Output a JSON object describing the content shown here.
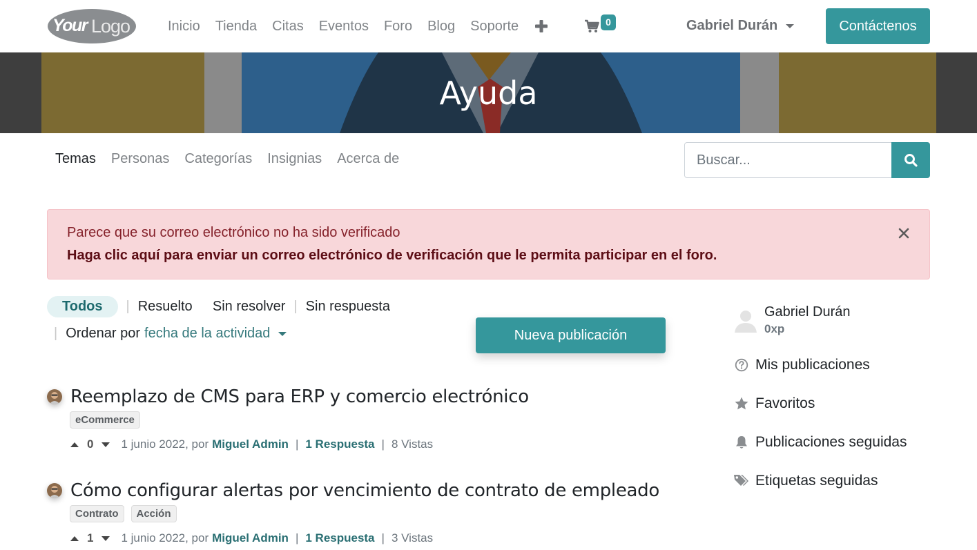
{
  "navbar": {
    "logo_text": "YourLogo",
    "links": [
      "Inicio",
      "Tienda",
      "Citas",
      "Eventos",
      "Foro",
      "Blog",
      "Soporte"
    ],
    "cart_count": "0",
    "user_name": "Gabriel Durán",
    "contact_label": "Contáctenos"
  },
  "banner": {
    "title": "Ayuda"
  },
  "forum_nav": {
    "tabs": [
      "Temas",
      "Personas",
      "Categorías",
      "Insignias",
      "Acerca de"
    ],
    "active_tab": "Temas",
    "search_placeholder": "Buscar..."
  },
  "alert": {
    "message": "Parece que su correo electrónico no ha sido verificado",
    "action": "Haga clic aquí para enviar un correo electrónico de verificación que le permita participar en el foro."
  },
  "filters": {
    "items": [
      "Todos",
      "Resuelto",
      "Sin resolver",
      "Sin respuesta"
    ],
    "active": "Todos",
    "order_label": "Ordenar por",
    "order_value": "fecha de la actividad",
    "new_post_label": "Nueva publicación"
  },
  "posts": [
    {
      "title": "Reemplazo de CMS para ERP y comercio electrónico",
      "tags": [
        "eCommerce"
      ],
      "votes": "0",
      "date": "1 junio 2022, por",
      "author": "Miguel Admin",
      "answers": "1 Respuesta",
      "views": "8 Vistas"
    },
    {
      "title": "Cómo configurar alertas por vencimiento de contrato de empleado",
      "tags": [
        "Contrato",
        "Acción"
      ],
      "votes": "1",
      "date": "1 junio 2022, por",
      "author": "Miguel Admin",
      "answers": "1 Respuesta",
      "views": "3 Vistas"
    }
  ],
  "sidebar": {
    "user_name": "Gabriel Durán",
    "xp": "0xp",
    "links": [
      "Mis publicaciones",
      "Favoritos",
      "Publicaciones seguidas",
      "Etiquetas seguidas"
    ]
  },
  "colors": {
    "primary": "#35979c",
    "alert_bg": "#f8d7da",
    "alert_text": "#842029"
  }
}
